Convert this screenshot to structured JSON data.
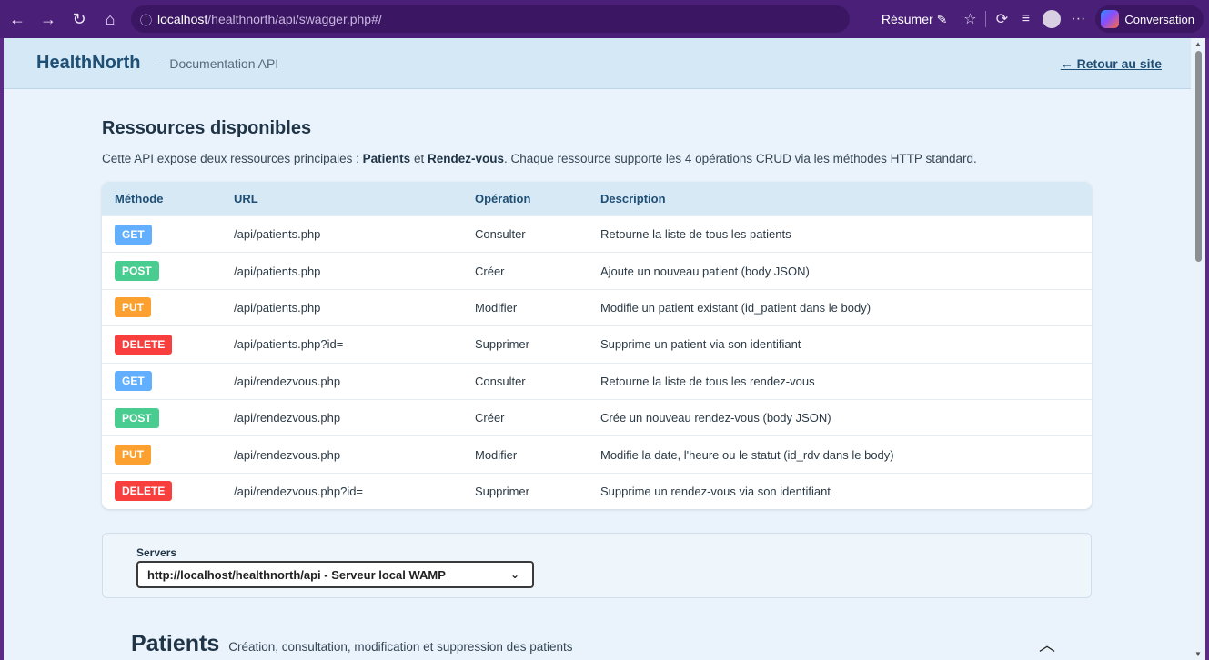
{
  "browser": {
    "url_host": "localhost",
    "url_path": "/healthnorth/api/swagger.php#/",
    "resumer_label": "Résumer",
    "conversation_label": "Conversation",
    "more_label": "···"
  },
  "header": {
    "brand": "HealthNorth",
    "subtitle": "— Documentation API",
    "back_link": "← Retour au site"
  },
  "resources": {
    "title": "Ressources disponibles",
    "desc_pre": "Cette API expose deux ressources principales : ",
    "desc_b1": "Patients",
    "desc_mid": " et ",
    "desc_b2": "Rendez-vous",
    "desc_post": ". Chaque ressource supporte les 4 opérations CRUD via les méthodes HTTP standard.",
    "columns": [
      "Méthode",
      "URL",
      "Opération",
      "Description"
    ],
    "rows": [
      {
        "method": "GET",
        "url": "/api/patients.php",
        "op": "Consulter",
        "desc": "Retourne la liste de tous les patients"
      },
      {
        "method": "POST",
        "url": "/api/patients.php",
        "op": "Créer",
        "desc": "Ajoute un nouveau patient (body JSON)"
      },
      {
        "method": "PUT",
        "url": "/api/patients.php",
        "op": "Modifier",
        "desc": "Modifie un patient existant (id_patient dans le body)"
      },
      {
        "method": "DELETE",
        "url": "/api/patients.php?id=",
        "op": "Supprimer",
        "desc": "Supprime un patient via son identifiant"
      },
      {
        "method": "GET",
        "url": "/api/rendezvous.php",
        "op": "Consulter",
        "desc": "Retourne la liste de tous les rendez-vous"
      },
      {
        "method": "POST",
        "url": "/api/rendezvous.php",
        "op": "Créer",
        "desc": "Crée un nouveau rendez-vous (body JSON)"
      },
      {
        "method": "PUT",
        "url": "/api/rendezvous.php",
        "op": "Modifier",
        "desc": "Modifie la date, l'heure ou le statut (id_rdv dans le body)"
      },
      {
        "method": "DELETE",
        "url": "/api/rendezvous.php?id=",
        "op": "Supprimer",
        "desc": "Supprime un rendez-vous via son identifiant"
      }
    ]
  },
  "method_colors": {
    "GET": "#61affe",
    "POST": "#49cc90",
    "PUT": "#fca130",
    "DELETE": "#f93e3e"
  },
  "servers": {
    "label": "Servers",
    "selected": "http://localhost/healthnorth/api - Serveur local WAMP"
  },
  "patients": {
    "title": "Patients",
    "desc": "Création, consultation, modification et suppression des patients"
  }
}
